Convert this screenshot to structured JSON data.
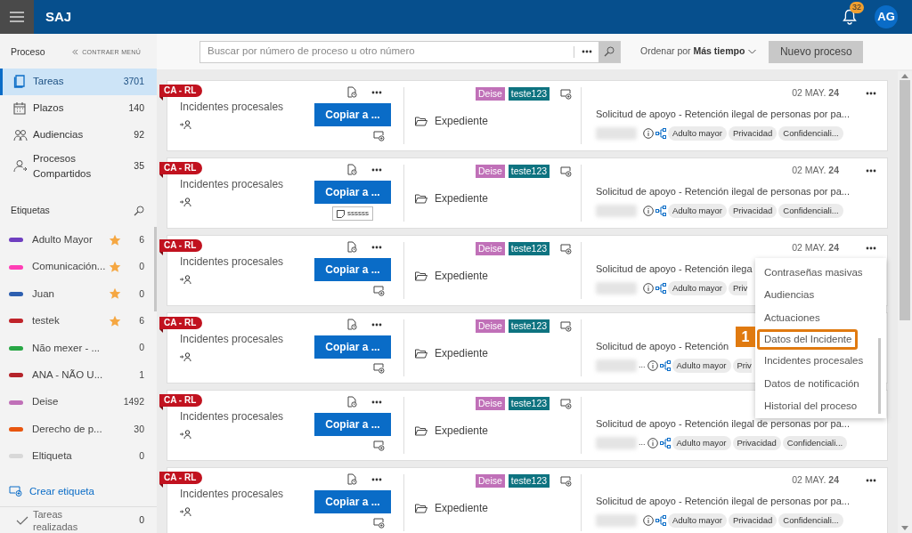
{
  "header": {
    "app_title": "SAJ",
    "notifications": "32",
    "avatar": "AG"
  },
  "sidebar": {
    "section_title": "Proceso",
    "collapse_label": "CONTRAER MENÚ",
    "nav": [
      {
        "label": "Tareas",
        "count": "3701",
        "kind": "tasks",
        "selected": true
      },
      {
        "label": "Plazos",
        "count": "140",
        "kind": "calendar",
        "selected": false
      },
      {
        "label": "Audiencias",
        "count": "92",
        "kind": "people",
        "selected": false
      },
      {
        "label": "Procesos Compartidos",
        "count": "35",
        "kind": "shared",
        "selected": false
      }
    ],
    "labels_title": "Etiquetas",
    "labels": [
      {
        "name": "Adulto Mayor",
        "color": "#6f3fc0",
        "starred": true,
        "count": "6"
      },
      {
        "name": "Comunicación...",
        "color": "#ff3eb5",
        "starred": true,
        "count": "0"
      },
      {
        "name": "Juan",
        "color": "#2d5fb0",
        "starred": true,
        "count": "0"
      },
      {
        "name": "testek",
        "color": "#c0232a",
        "starred": true,
        "count": "6"
      },
      {
        "name": "Não mexer - ...",
        "color": "#28a745",
        "starred": false,
        "count": "0"
      },
      {
        "name": "ANA - NÃO U...",
        "color": "#b5232a",
        "starred": false,
        "count": "1"
      },
      {
        "name": "Deise",
        "color": "#c070b8",
        "starred": false,
        "count": "1492"
      },
      {
        "name": "Derecho de p...",
        "color": "#e8560f",
        "starred": false,
        "count": "30"
      },
      {
        "name": "Eltiqueta",
        "color": "#d8d8d8",
        "starred": false,
        "count": "0"
      }
    ],
    "create_label": "Crear etiqueta",
    "done": {
      "label": "Tareas realizadas",
      "count": "0"
    }
  },
  "toolbar": {
    "search_placeholder": "Buscar por número de proceso u otro número",
    "sort_label": "Ordenar por",
    "sort_value": "Más tiempo",
    "new_button": "Nuevo proceso"
  },
  "cards": [
    {
      "tag": "CA - RL",
      "type": "Incidentes procesales",
      "copy_button": "Copiar a ...",
      "labels": [
        {
          "name": "Deise",
          "color": "#c070b8"
        },
        {
          "name": "teste123",
          "color": "#0e7380"
        }
      ],
      "folder": "Expediente",
      "date": "02 MAY. **24**",
      "title": "Solicitud de apoyo - Retención ilegal de personas por pa...",
      "chips": [
        {
          "text": "Adulto mayor",
          "cut": false
        },
        {
          "text": "Privacidad",
          "cut": false
        },
        {
          "text": "Confidenciali...",
          "cut": false
        }
      ]
    },
    {
      "tag": "CA - RL",
      "type": "Incidentes procesales",
      "copy_button": "Copiar a ...",
      "note": "ssssss",
      "labels": [
        {
          "name": "Deise",
          "color": "#c070b8"
        },
        {
          "name": "teste123",
          "color": "#0e7380"
        }
      ],
      "folder": "Expediente",
      "date": "02 MAY. **24**",
      "title": "Solicitud de apoyo - Retención ilegal de personas por pa...",
      "chips": [
        {
          "text": "Adulto mayor",
          "cut": false
        },
        {
          "text": "Privacidad",
          "cut": false
        },
        {
          "text": "Confidenciali...",
          "cut": false
        }
      ]
    },
    {
      "tag": "CA - RL",
      "type": "Incidentes procesales",
      "copy_button": "Copiar a ...",
      "labels": [
        {
          "name": "Deise",
          "color": "#c070b8"
        },
        {
          "name": "teste123",
          "color": "#0e7380"
        }
      ],
      "folder": "Expediente",
      "date": "02 MAY. **24**",
      "title": "Solicitud de apoyo - Retención ilega",
      "chips": [
        {
          "text": "Adulto mayor",
          "cut": false
        },
        {
          "text": "Priv",
          "cut": true
        }
      ]
    },
    {
      "tag": "CA - RL",
      "type": "Incidentes procesales",
      "copy_button": "Copiar a ...",
      "labels": [
        {
          "name": "Deise",
          "color": "#c070b8"
        },
        {
          "name": "teste123",
          "color": "#0e7380"
        }
      ],
      "folder": "Expediente",
      "title": "Solicitud de apoyo - Retención",
      "redacted_suffix": "...",
      "chips": [
        {
          "text": "Adulto mayor",
          "cut": false
        },
        {
          "text": "Priv",
          "cut": true
        }
      ]
    },
    {
      "tag": "CA - RL",
      "type": "Incidentes procesales",
      "copy_button": "Copiar a ...",
      "labels": [
        {
          "name": "Deise",
          "color": "#c070b8"
        },
        {
          "name": "teste123",
          "color": "#0e7380"
        }
      ],
      "folder": "Expediente",
      "title": "Solicitud de apoyo - Retención ilegal de personas por pa...",
      "redacted_suffix": "...",
      "chips": [
        {
          "text": "Adulto mayor",
          "cut": false
        },
        {
          "text": "Privacidad",
          "cut": false
        },
        {
          "text": "Confidenciali...",
          "cut": false
        }
      ]
    },
    {
      "tag": "CA - RL",
      "type": "Incidentes procesales",
      "copy_button": "Copiar a ...",
      "labels": [
        {
          "name": "Deise",
          "color": "#c070b8"
        },
        {
          "name": "teste123",
          "color": "#0e7380"
        }
      ],
      "folder": "Expediente",
      "date": "02 MAY. **24**",
      "title": "Solicitud de apoyo - Retención ilegal de personas por pa...",
      "chips": [
        {
          "text": "Adulto mayor",
          "cut": false
        },
        {
          "text": "Privacidad",
          "cut": false
        },
        {
          "text": "Confidenciali...",
          "cut": false
        }
      ]
    }
  ],
  "context_menu": {
    "callout": "1",
    "items": [
      {
        "label": "Contraseñas masivas",
        "selected": false
      },
      {
        "label": "Audiencias",
        "selected": false
      },
      {
        "label": "Actuaciones",
        "selected": false
      },
      {
        "label": "Datos del Incidente",
        "selected": true
      },
      {
        "label": "Incidentes procesales",
        "selected": false
      },
      {
        "label": "Datos de notificación",
        "selected": false
      },
      {
        "label": "Historial del proceso",
        "selected": false
      }
    ]
  }
}
